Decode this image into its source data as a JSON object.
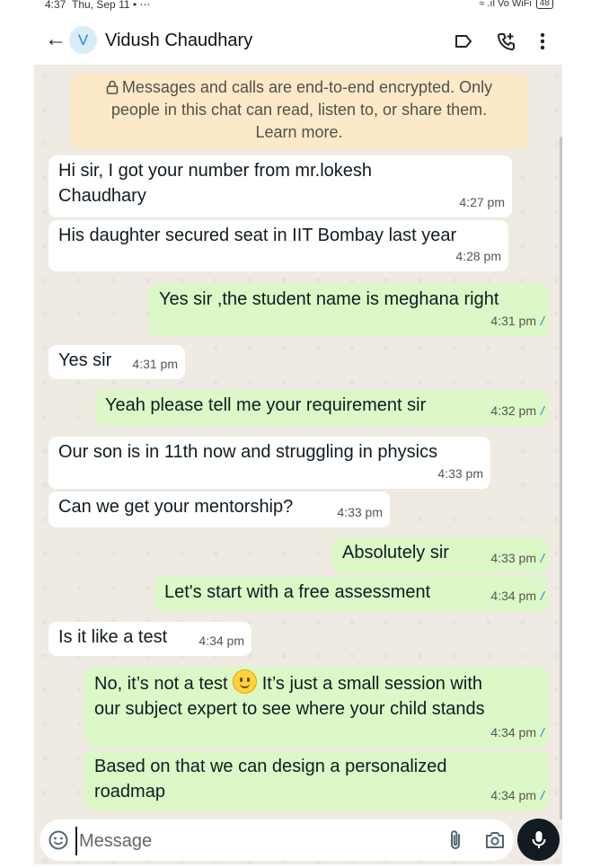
{
  "status_bar": {
    "time": "4:37",
    "date": "Thu, Sep 11",
    "extras": "• ⋯",
    "signals": "≈ .ıl Vo WiFi",
    "battery": "48"
  },
  "header": {
    "contact_name": "Vidush Chaudhary",
    "avatar_letter": "V",
    "icons": [
      "back-arrow-icon",
      "label-icon",
      "add-call-icon",
      "more-options-icon"
    ]
  },
  "encryption_notice": {
    "line1": "Messages and calls are end-to-end encrypted. Only",
    "line2": "people in this chat can read, listen to, or share them.",
    "link": "Learn more."
  },
  "messages": [
    {
      "direction": "incoming",
      "text_line1": "Hi sir, I got your number from mr.lokesh",
      "text_line2": "Chaudhary",
      "time": "4:27 pm"
    },
    {
      "direction": "incoming",
      "text": "His daughter secured seat in IIT Bombay last year",
      "time": "4:28 pm"
    },
    {
      "direction": "outgoing",
      "text": "Yes sir ,the student name is meghana right",
      "time": "4:31 pm"
    },
    {
      "direction": "incoming",
      "text": "Yes sir",
      "time": "4:31 pm"
    },
    {
      "direction": "outgoing",
      "text": "Yeah please tell me your requirement sir",
      "time": "4:32 pm"
    },
    {
      "direction": "incoming",
      "text": "Our son is in 11th now and struggling in physics",
      "time": "4:33 pm"
    },
    {
      "direction": "incoming",
      "text": "Can we get your mentorship?",
      "time": "4:33 pm"
    },
    {
      "direction": "outgoing",
      "text": "Absolutely sir",
      "time": "4:33 pm"
    },
    {
      "direction": "outgoing",
      "text": "Let's start with a free assessment",
      "time": "4:34 pm"
    },
    {
      "direction": "incoming",
      "text": "Is it like a test",
      "time": "4:34 pm"
    },
    {
      "direction": "outgoing",
      "text_part1": "No, it’s not a test",
      "text_part2": "It’s just a small session with",
      "text_line2": "our subject expert to see where your child stands",
      "time": "4:34 pm"
    },
    {
      "direction": "outgoing",
      "text_line1": "Based on that we can design a personalized",
      "text_line2": "roadmap",
      "time": "4:34 pm"
    }
  ],
  "composer": {
    "placeholder": "Message",
    "icons": [
      "emoji-icon",
      "attach-icon",
      "camera-icon",
      "mic-icon"
    ]
  },
  "colors": {
    "outgoing_bubble": "#dcf8c6",
    "incoming_bubble": "#ffffff",
    "chat_background": "#efeae2",
    "encryption_banner": "#fbe9c8",
    "read_ticks": "#3b93d6"
  }
}
